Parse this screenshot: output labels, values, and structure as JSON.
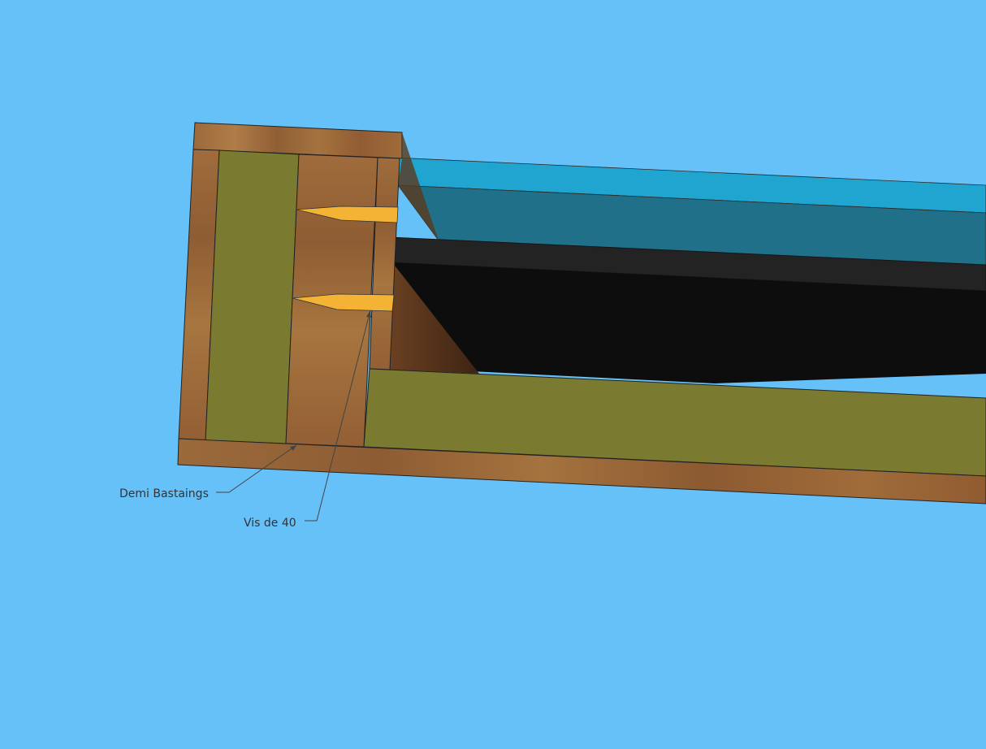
{
  "callouts": [
    {
      "id": "demi-bastaings",
      "text": "Demi Bastaings"
    },
    {
      "id": "vis-de-40",
      "text": "Vis de 40"
    }
  ],
  "colors": {
    "background": "#67c1f9",
    "wood": "#9a6a3c",
    "wood_dark": "#6b4426",
    "insulation": "#7a7b31",
    "glass": "#1fa6cf",
    "glass_dark": "#1e7289",
    "panel": "#222222",
    "panel_black": "#0d0d0d",
    "screw": "#f5b335"
  }
}
